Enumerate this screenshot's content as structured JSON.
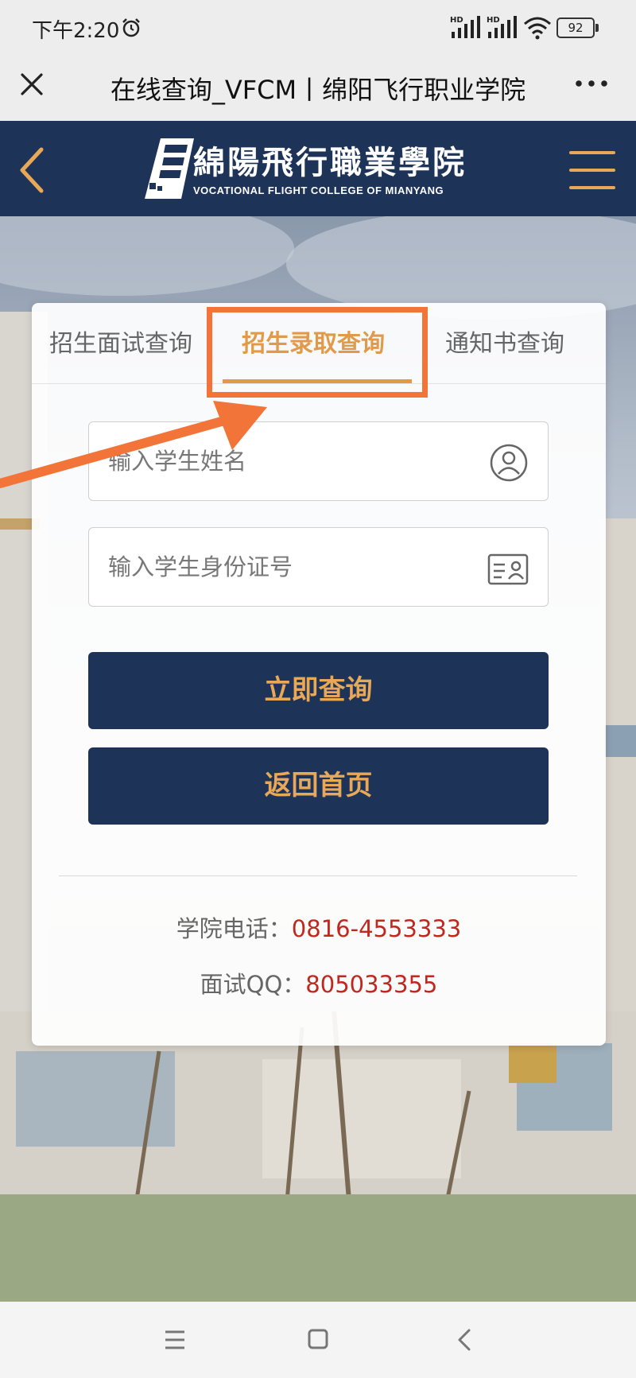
{
  "status_bar": {
    "time": "下午2:20",
    "network_1": "HD",
    "network_2": "HD",
    "battery": "92"
  },
  "nav": {
    "title": "在线查询_VFCM丨绵阳飞行职业学院"
  },
  "site_header": {
    "logo_cn": "綿陽飛行職業學院",
    "logo_en": "VOCATIONAL FLIGHT COLLEGE OF MIANYANG"
  },
  "tabs": [
    {
      "label": "招生面试查询",
      "active": false
    },
    {
      "label": "招生录取查询",
      "active": true
    },
    {
      "label": "通知书查询",
      "active": false
    }
  ],
  "form": {
    "name_placeholder": "输入学生姓名",
    "id_placeholder": "输入学生身份证号",
    "name_value": "",
    "id_value": ""
  },
  "buttons": {
    "query": "立即查询",
    "home": "返回首页"
  },
  "contact": {
    "phone_label": "学院电话：",
    "phone_value": "0816-4553333",
    "qq_label": "面试QQ：",
    "qq_value": "805033355"
  },
  "colors": {
    "navy": "#1e3358",
    "gold": "#e8a857",
    "accent_red": "#c0281e",
    "annotation": "#f27439"
  },
  "icons": {
    "close": "close-icon",
    "more": "more-icon",
    "back": "chevron-left-icon",
    "menu": "hamburger-icon",
    "user": "user-circle-icon",
    "id_card": "id-card-icon"
  }
}
